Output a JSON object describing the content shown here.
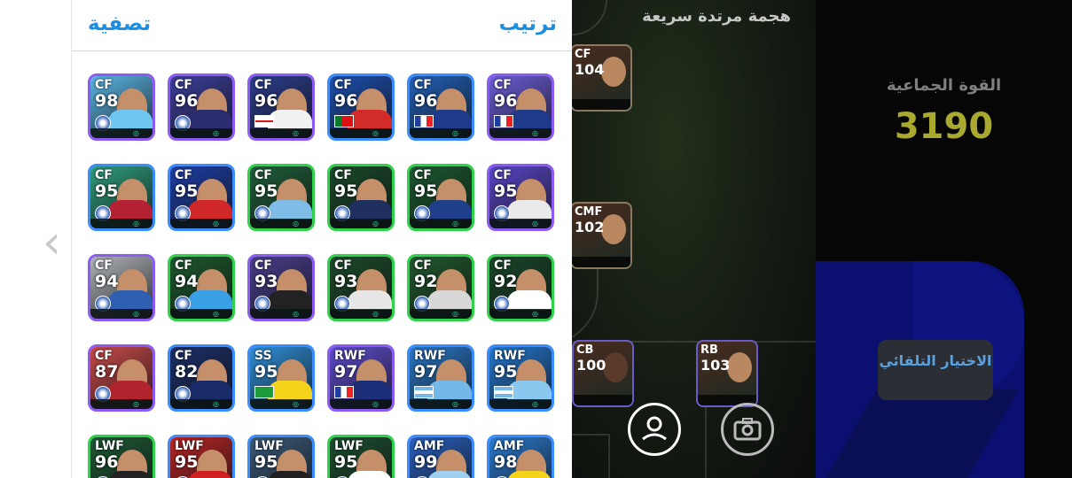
{
  "header": {
    "filter_label": "تصفية",
    "sort_label": "ترتيب"
  },
  "left_nav": {
    "chevron": "‹"
  },
  "cards": [
    {
      "pos": "CF",
      "rating": "98",
      "border": "purple",
      "bg": "#5bb6e6",
      "torso": "#6fc6f0",
      "flag": "club-badge"
    },
    {
      "pos": "CF",
      "rating": "96",
      "border": "purple",
      "bg": "#3d3f9e",
      "torso": "#2b2d6e",
      "flag": "club-badge"
    },
    {
      "pos": "CF",
      "rating": "96",
      "border": "purple",
      "bg": "#2c3e8e",
      "torso": "#f1f1f1",
      "flag": "england"
    },
    {
      "pos": "CF",
      "rating": "96",
      "border": "blue",
      "bg": "#1e4fb0",
      "torso": "#d32a2a",
      "flag": "portugal"
    },
    {
      "pos": "CF",
      "rating": "96",
      "border": "blue",
      "bg": "#2260b8",
      "torso": "#1f3a8a",
      "flag": "france"
    },
    {
      "pos": "CF",
      "rating": "96",
      "border": "purple",
      "bg": "#6c5ed8",
      "torso": "#1f3a8a",
      "flag": "france"
    },
    {
      "pos": "CF",
      "rating": "95",
      "border": "blue",
      "bg": "#2f9e7e",
      "torso": "#b52134",
      "flag": "club-badge"
    },
    {
      "pos": "CF",
      "rating": "95",
      "border": "blue",
      "bg": "#1d3fa7",
      "torso": "#d02828",
      "flag": "club-badge"
    },
    {
      "pos": "CF",
      "rating": "95",
      "border": "green",
      "bg": "#1f5f3b",
      "torso": "#7fbde6",
      "flag": "club-badge"
    },
    {
      "pos": "CF",
      "rating": "95",
      "border": "green",
      "bg": "#1a4a2a",
      "torso": "#1f2f5f",
      "flag": "club-badge"
    },
    {
      "pos": "CF",
      "rating": "95",
      "border": "green",
      "bg": "#1b5a30",
      "torso": "#1f3f8a",
      "flag": "club-badge"
    },
    {
      "pos": "CF",
      "rating": "95",
      "border": "purple",
      "bg": "#5b46c8",
      "torso": "#eaeaea",
      "flag": "club-badge"
    },
    {
      "pos": "CF",
      "rating": "94",
      "border": "purple",
      "bg": "#b0b4ba",
      "torso": "#2f5fb0",
      "flag": "club-badge"
    },
    {
      "pos": "CF",
      "rating": "94",
      "border": "green",
      "bg": "#1d5a2e",
      "torso": "#3aa0e6",
      "flag": "club-badge"
    },
    {
      "pos": "CF",
      "rating": "93",
      "border": "purple",
      "bg": "#4a3f8e",
      "torso": "#222222",
      "flag": "club-badge"
    },
    {
      "pos": "CF",
      "rating": "93",
      "border": "green",
      "bg": "#1c4b2b",
      "torso": "#e6e6e6",
      "flag": "club-badge"
    },
    {
      "pos": "CF",
      "rating": "92",
      "border": "green",
      "bg": "#215a2f",
      "torso": "#d8d8d8",
      "flag": "club-badge"
    },
    {
      "pos": "CF",
      "rating": "92",
      "border": "green",
      "bg": "#19482a",
      "torso": "#ffffff",
      "flag": "club-badge"
    },
    {
      "pos": "CF",
      "rating": "87",
      "border": "purple",
      "bg": "#c84a4a",
      "torso": "#b0242d",
      "flag": "club-badge"
    },
    {
      "pos": "CF",
      "rating": "82",
      "border": "blue",
      "bg": "#1b2f6a",
      "torso": "#1a2b6a",
      "flag": "club-badge"
    },
    {
      "pos": "SS",
      "rating": "95",
      "border": "blue",
      "bg": "#2f8fd8",
      "torso": "#f4d41a",
      "flag": "brazil"
    },
    {
      "pos": "RWF",
      "rating": "97",
      "border": "purple",
      "bg": "#5f4ed0",
      "torso": "#1e2f7a",
      "flag": "france"
    },
    {
      "pos": "RWF",
      "rating": "97",
      "border": "blue",
      "bg": "#2a78c8",
      "torso": "#74b8ea",
      "flag": "argentina"
    },
    {
      "pos": "RWF",
      "rating": "95",
      "border": "blue",
      "bg": "#2478d0",
      "torso": "#8ac8f0",
      "flag": "argentina"
    },
    {
      "pos": "LWF",
      "rating": "96",
      "border": "green",
      "bg": "#1d5a34",
      "torso": "#222222",
      "flag": "club-badge"
    },
    {
      "pos": "LWF",
      "rating": "95",
      "border": "blue",
      "bg": "#b82525",
      "torso": "#d02020",
      "flag": "club-badge"
    },
    {
      "pos": "LWF",
      "rating": "95",
      "border": "blue",
      "bg": "#3a5a7a",
      "torso": "#202020",
      "flag": "club-badge"
    },
    {
      "pos": "LWF",
      "rating": "95",
      "border": "green",
      "bg": "#1c5030",
      "torso": "#ffffff",
      "flag": "club-badge"
    },
    {
      "pos": "AMF",
      "rating": "99",
      "border": "blue",
      "bg": "#2a60c0",
      "torso": "#9fd0f0",
      "flag": "club-badge"
    },
    {
      "pos": "AMF",
      "rating": "98",
      "border": "blue",
      "bg": "#2b7bd0",
      "torso": "#f4d41a",
      "flag": "club-badge"
    }
  ],
  "field": {
    "title": "هجمة مرتدة سريعة",
    "players": [
      {
        "pos": "CF",
        "rating": "104",
        "name": "field-player-cf"
      },
      {
        "pos": "CMF",
        "rating": "102",
        "name": "field-player-cmf"
      },
      {
        "pos": "CB",
        "rating": "100",
        "name": "field-player-cb"
      },
      {
        "pos": "RB",
        "rating": "103",
        "name": "field-player-rb"
      }
    ]
  },
  "team": {
    "strength_label": "القوة الجماعية",
    "strength_value": "3190",
    "auto_select_label": "الاختيار التلقائي"
  },
  "colors": {
    "accent": "#1e8ee0",
    "strength": "#a9a930",
    "green_border": "#2fd14a",
    "purple_border": "#8c5cf2",
    "blue_border": "#3a8cff"
  }
}
